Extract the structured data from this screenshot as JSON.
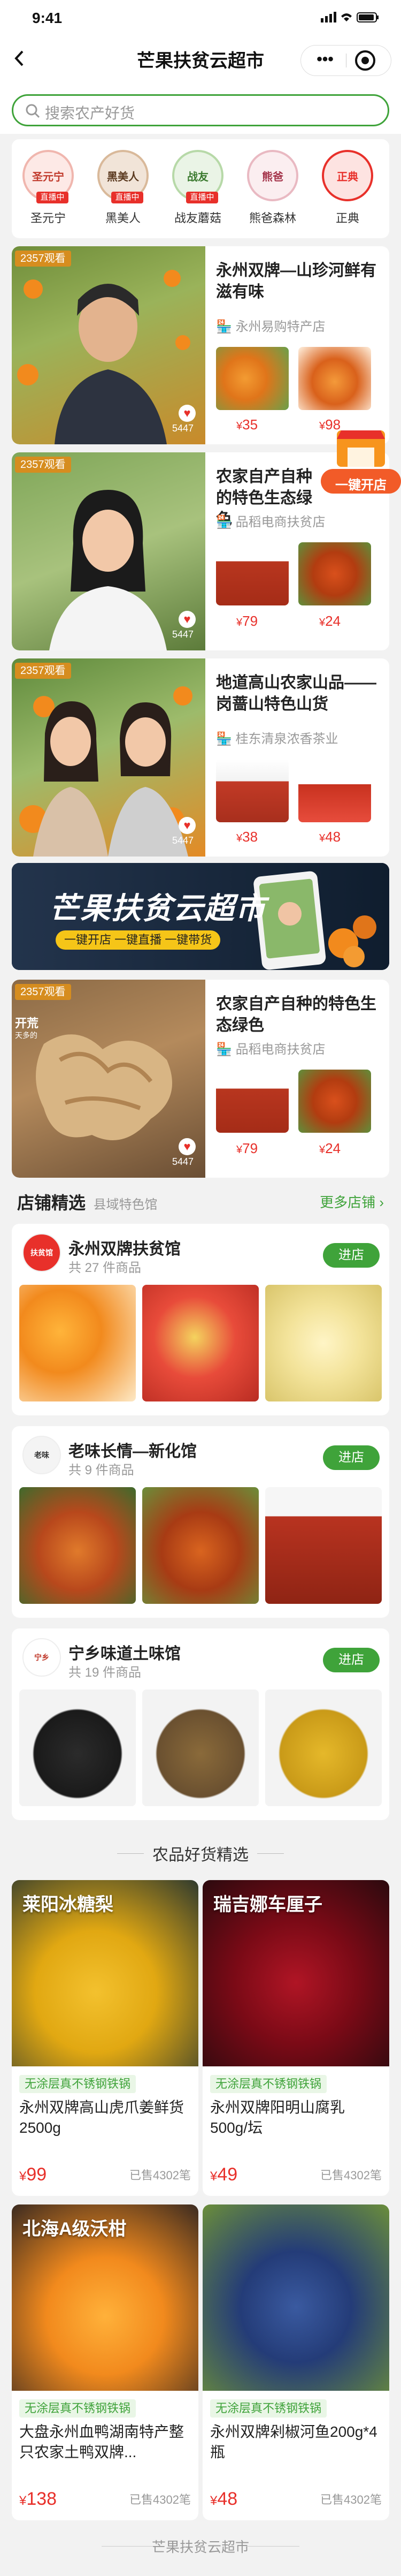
{
  "status": {
    "time": "9:41"
  },
  "header": {
    "title": "芒果扶贫云超市"
  },
  "search": {
    "placeholder": "搜索农产好货"
  },
  "stores": [
    {
      "name": "圣元宁",
      "badge": "直播中",
      "logo": "圣元宁"
    },
    {
      "name": "黑美人",
      "badge": "直播中",
      "logo": "黑美人"
    },
    {
      "name": "战友蘑菇",
      "badge": "直播中",
      "logo": "战友"
    },
    {
      "name": "熊爸森林",
      "badge": "",
      "logo": "熊爸"
    },
    {
      "name": "正典",
      "badge": "",
      "logo": "正典"
    }
  ],
  "lives": [
    {
      "viewers": "2357观看",
      "likes": "5447",
      "title": "永州双牌—山珍河鲜有滋有味",
      "shop": "永州易购特产店",
      "prices": [
        "35",
        "98"
      ]
    },
    {
      "viewers": "2357观看",
      "likes": "5447",
      "title": "农家自产自种的特色生态绿色",
      "shop": "品稻电商扶贫店",
      "prices": [
        "79",
        "24"
      ]
    },
    {
      "viewers": "2357观看",
      "likes": "5447",
      "title": "地道高山农家山品——岗蔷山特色山货",
      "shop": "桂东清泉浓香茶业",
      "prices": [
        "38",
        "48"
      ]
    },
    {
      "viewers": "2357观看",
      "likes": "5447",
      "title": "农家自产自种的特色生态绿色",
      "shop": "品稻电商扶贫店",
      "prices": [
        "79",
        "24"
      ],
      "status": "开荒",
      "status_sub": "天多的"
    }
  ],
  "banner": {
    "title": "芒果扶贫云超市",
    "slogan": "一键开店 一键直播 一键带货"
  },
  "float": {
    "label": "一键开店"
  },
  "shops_section": {
    "title": "店铺精选",
    "subtitle": "县域特色馆",
    "more": "更多店铺 ›"
  },
  "shops": [
    {
      "name": "永州双牌扶贫馆",
      "count": "共 27 件商品",
      "button": "进店",
      "logo": "扶贫馆"
    },
    {
      "name": "老味长情—新化馆",
      "count": "共 9 件商品",
      "button": "进店",
      "logo": "老味"
    },
    {
      "name": "宁乡味道土味馆",
      "count": "共 19 件商品",
      "button": "进店",
      "logo": "宁乡"
    }
  ],
  "products_section": {
    "title": "农品好货精选"
  },
  "products": [
    {
      "label": "莱阳冰糖梨",
      "tag": "无涂层真不锈钢铁锅",
      "name": "永州双牌高山虎爪姜鲜货2500g",
      "price": "99",
      "sold": "已售4302笔"
    },
    {
      "label": "瑞吉娜车厘子",
      "tag": "无涂层真不锈钢铁锅",
      "name": "永州双牌阳明山腐乳500g/坛",
      "price": "49",
      "sold": "已售4302笔"
    },
    {
      "label": "北海A级沃柑",
      "tag": "无涂层真不锈钢铁锅",
      "name": "大盘永州血鸭湖南特产整只农家土鸭双牌...",
      "price": "138",
      "sold": "已售4302笔"
    },
    {
      "label": "",
      "tag": "无涂层真不锈钢铁锅",
      "name": "永州双牌剁椒河鱼200g*4瓶",
      "price": "48",
      "sold": "已售4302笔"
    }
  ],
  "footer": {
    "text": "芒果扶贫云超市"
  },
  "colors": {
    "accent": "#3fa33a",
    "price": "#e8302a",
    "live_badge": "#d68d1f"
  }
}
